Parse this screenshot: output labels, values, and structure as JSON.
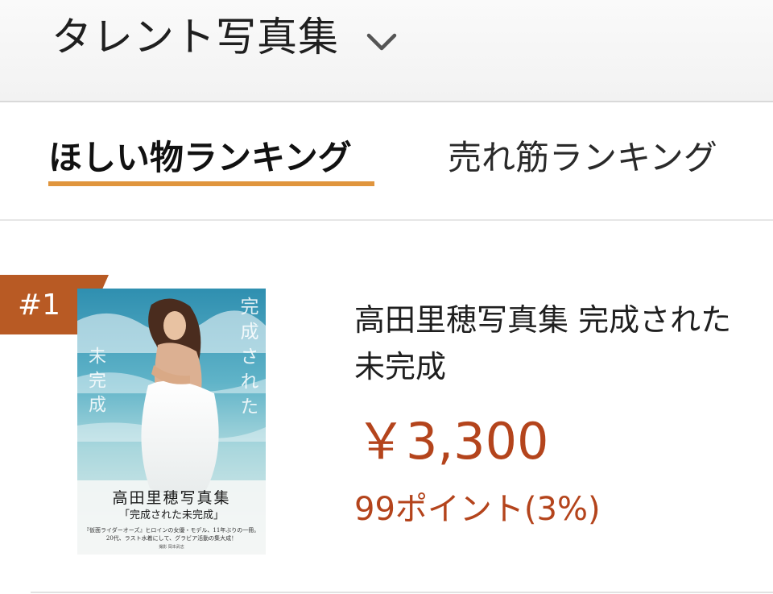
{
  "header": {
    "category_title": "タレント写真集",
    "dropdown_icon": "chevron-down-icon"
  },
  "tabs": [
    {
      "label": "ほしい物ランキング",
      "active": true
    },
    {
      "label": "売れ筋ランキング",
      "active": false
    }
  ],
  "colors": {
    "accent_underline": "#e0953d",
    "rank_badge": "#b85a24",
    "price": "#b4441c"
  },
  "ranking": [
    {
      "rank": "#1",
      "title": "高田里穂写真集 完成された未完成",
      "price": "￥3,300",
      "points": "99ポイント(3%)",
      "cover": {
        "title": "高田里穂写真集",
        "subtitle": "「完成された未完成」",
        "vertical_right": "完成された",
        "vertical_left": "未完成",
        "copy_line1": "『仮面ライダーオーズ』ヒロインの女優・モデル、11年ぶりの一冊。",
        "copy_line2": "20代、ラスト水着にして、グラビア活動の集大成！",
        "credit": "撮影 岡本武志"
      }
    }
  ]
}
